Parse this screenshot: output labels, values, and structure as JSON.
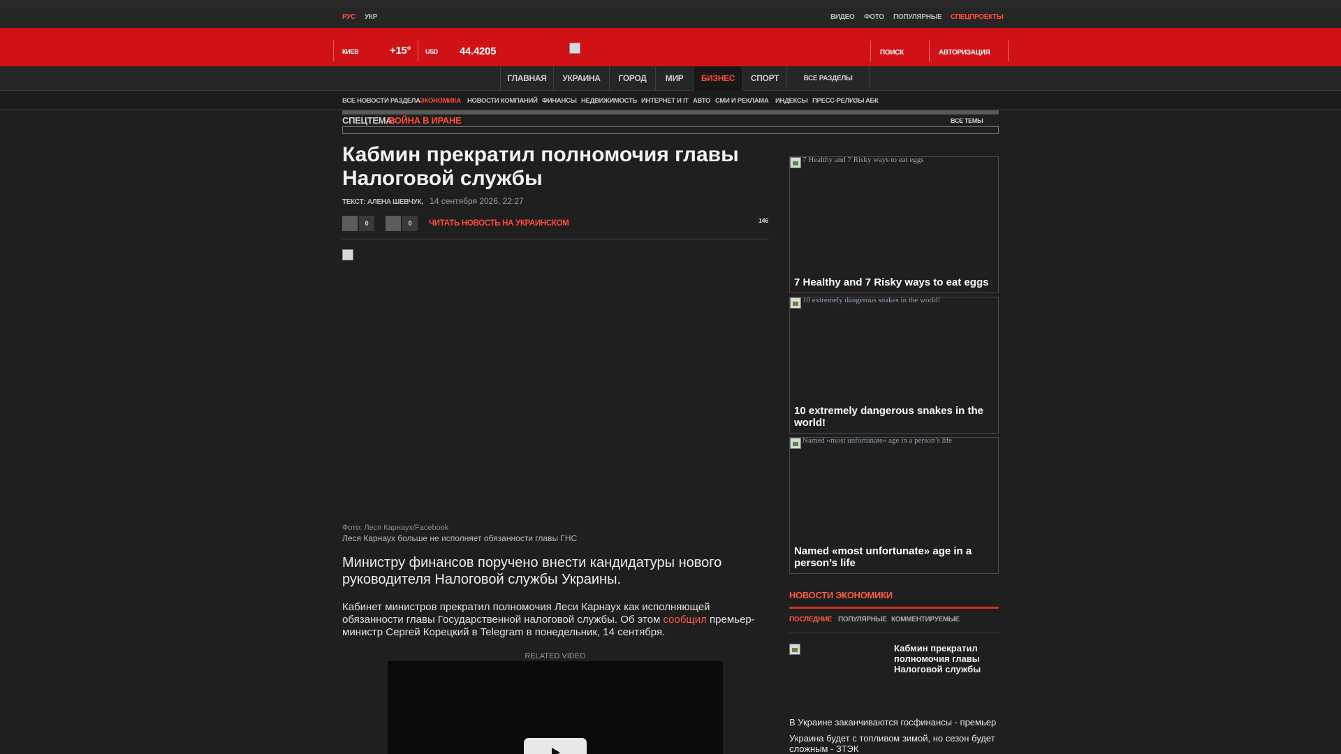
{
  "lang": {
    "ru": "РУС",
    "ua": "УКР"
  },
  "top_links": [
    "ВИДЕО",
    "ФОТО",
    "ПОПУЛЯРНЫЕ",
    "СПЕЦПРОЕКТЫ"
  ],
  "header": {
    "city": "КИЕВ",
    "temperature": "+15°",
    "currency": "USD",
    "rate": "44.4205",
    "search": "ПОИСК",
    "auth": "АВТОРИЗАЦИЯ"
  },
  "main_nav": [
    "ГЛАВНАЯ",
    "УКРАИНА",
    "ГОРОД",
    "МИР",
    "БИЗНЕС",
    "СПОРТ",
    "ВСЕ РАЗДЕЛЫ"
  ],
  "main_nav_active": "БИЗНЕС",
  "sub_nav": [
    "ВСЕ НОВОСТИ РАЗДЕЛА",
    "ЭКОНОМИКА",
    "НОВОСТИ КОМПАНИЙ",
    "ФИНАНСЫ",
    "НЕДВИЖИМОСТЬ",
    "ИНТЕРНЕТ И IT",
    "АВТО",
    "СМИ И РЕКЛАМА",
    "ИНДЕКСЫ",
    "ПРЕСС-РЕЛИЗЫ",
    "АБК"
  ],
  "spectema": {
    "label": "СПЕЦТЕМА:",
    "topic": "ВОЙНА В ИРАНЕ",
    "all_topics": "ВСЕ ТЕМЫ"
  },
  "article": {
    "title": "Кабмин прекратил полномочия главы Налоговой службы",
    "author": "ТЕКСТ: АЛЕНА ШЕВЧУК,",
    "date": "14 сентября 2026, 22:27",
    "share_count_1": "0",
    "share_count_2": "0",
    "read_ukrainian": "ЧИТАТЬ НОВОСТЬ НА УКРАИНСКОМ",
    "views": "146",
    "photo_credit": "Фото: Леся Карнаух/Facebook",
    "photo_caption": "Леся Карнаух больше не исполняет обязанности главы ГНС",
    "lead": "Министру финансов поручено внести кандидатуры нового руководителя Налоговой службы Украины.",
    "body_before_link": "Кабинет министров прекратил полномочия Леси Карнаух как исполняющей обязанности главы Государственной налоговой службы. Об этом ",
    "body_link": "сообщил",
    "body_after_link": " премьер-министр Сергей Корецкий в Telegram в понедельник, 14 сентября.",
    "related_video": "RELATED VIDEO"
  },
  "sidebar_cards": [
    {
      "alt": "7 Healthy and 7 Risky ways to eat eggs",
      "title": "7 Healthy and 7 Risky ways to eat eggs"
    },
    {
      "alt": "10 extremely dangerous snakes in the world!",
      "title": "10 extremely dangerous snakes in the world!"
    },
    {
      "alt": "Named «most unfortunate» age in a person’s life",
      "title": "Named «most unfortunate» age in a person’s life"
    }
  ],
  "economy_news": {
    "title": "НОВОСТИ ЭКОНОМИКИ",
    "tabs": [
      "ПОСЛЕДНИЕ",
      "ПОПУЛЯРНЫЕ",
      "КОММЕНТИРУЕМЫЕ"
    ],
    "active_tab": "ПОСЛЕДНИЕ",
    "feature_title": "Кабмин прекратил полномочия главы Налоговой службы",
    "items": [
      "В Украине заканчиваются госфинансы - премьер",
      "Украина будет с топливом зимой, но сезон будет сложным - ЗТЭК"
    ]
  },
  "colors": {
    "brand_red": "#d01116",
    "accent_orange": "#ff4b3c",
    "background": "#1f1f1f"
  }
}
